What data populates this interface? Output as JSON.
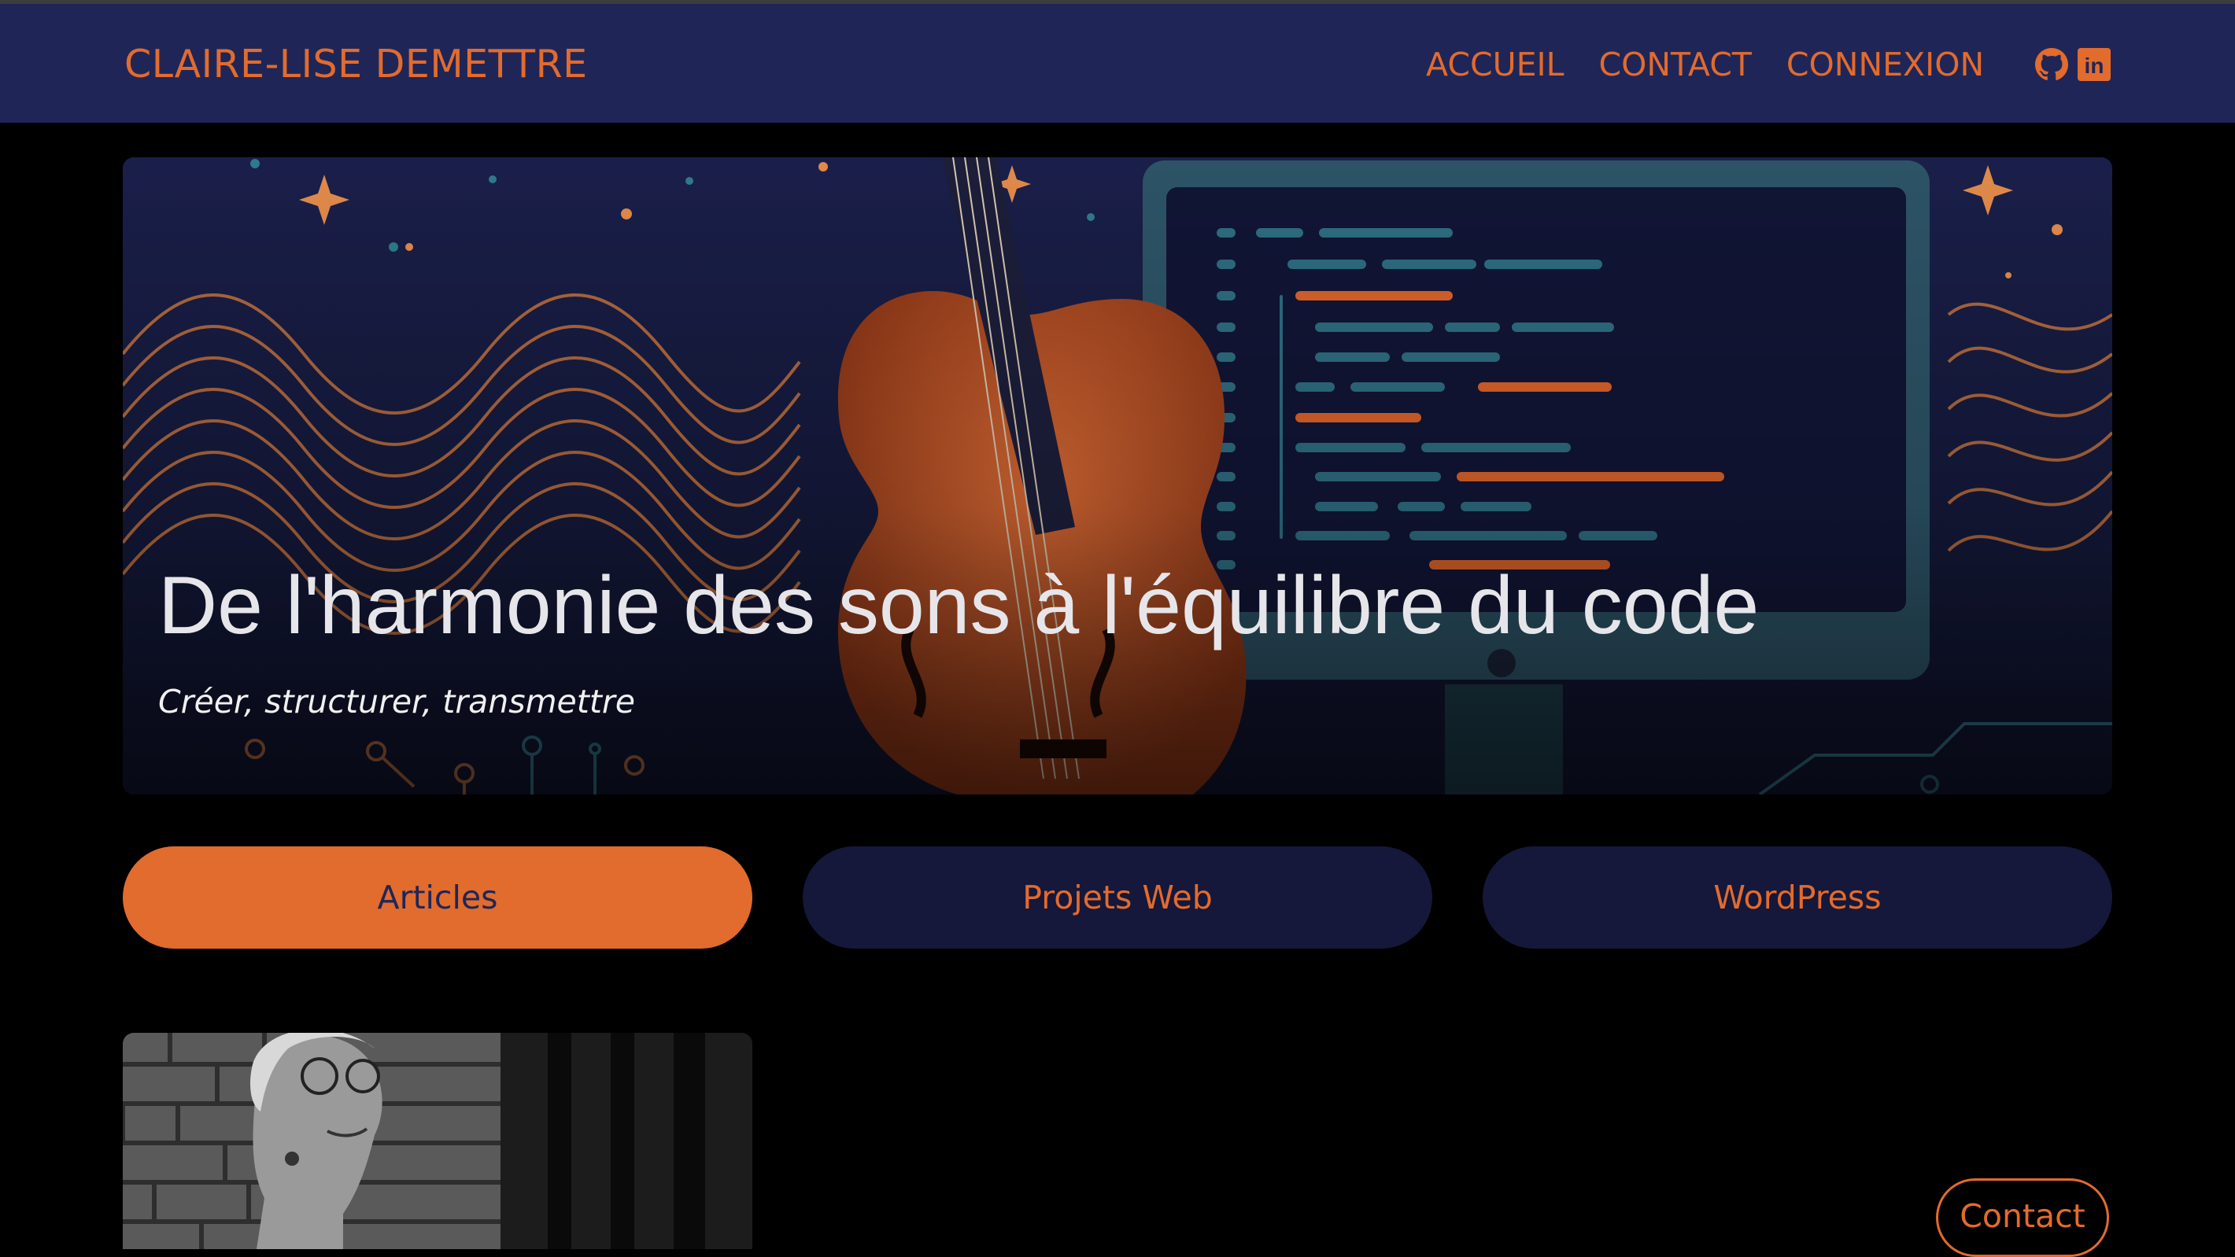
{
  "navbar": {
    "brand": "CLAIRE-LISE DEMETTRE",
    "links": [
      {
        "label": "ACCUEIL"
      },
      {
        "label": "CONTACT"
      },
      {
        "label": "CONNEXION"
      }
    ],
    "social_icons": [
      "github-icon",
      "linkedin-icon"
    ],
    "linkedin_glyph": "in"
  },
  "hero": {
    "title": "De l'harmonie des sons à l'équilibre du code",
    "subtitle": "Créer, structurer, transmettre"
  },
  "tabs": [
    {
      "label": "Articles",
      "active": true
    },
    {
      "label": "Projets Web",
      "active": false
    },
    {
      "label": "WordPress",
      "active": false
    }
  ],
  "contact_button": {
    "label": "Contact"
  },
  "colors": {
    "accent": "#e26b2e",
    "navbar_bg": "#1f2657",
    "page_bg": "#000000",
    "tab_bg": "#15183a",
    "hero_text": "#e6e6ea"
  }
}
